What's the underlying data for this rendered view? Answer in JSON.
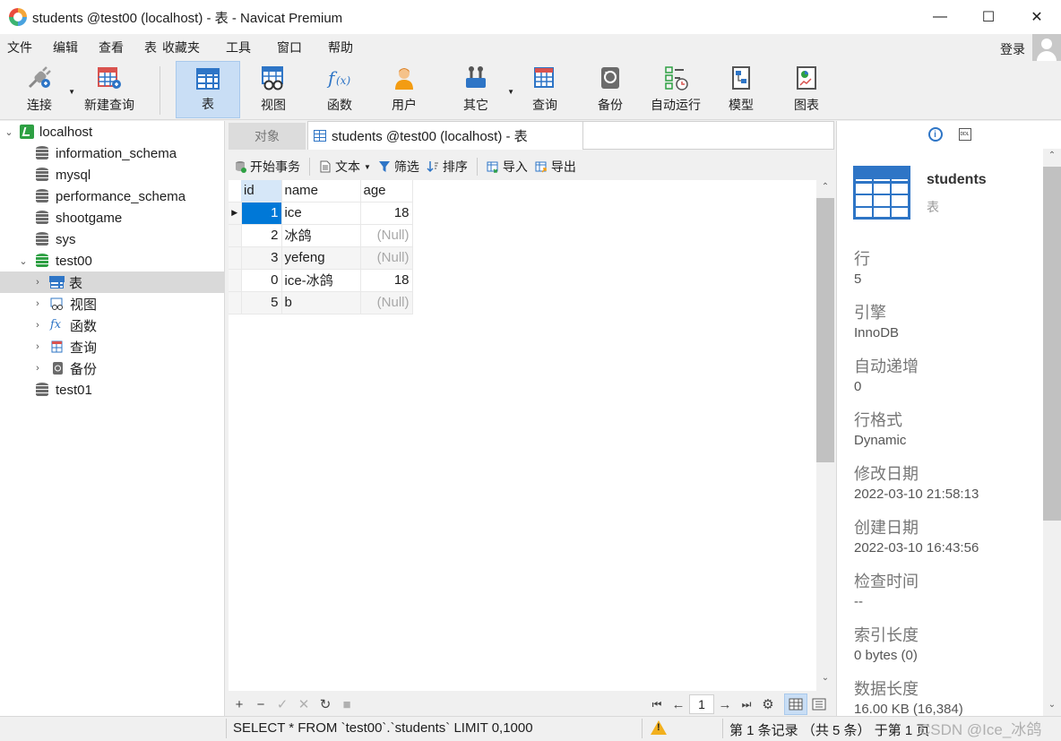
{
  "window": {
    "title": "students @test00 (localhost) - 表 - Navicat Premium",
    "min": "—",
    "max": "☐",
    "close": "✕"
  },
  "menu": [
    "文件",
    "编辑",
    "查看",
    "表",
    "收藏夹",
    "工具",
    "窗口",
    "帮助"
  ],
  "login_label": "登录",
  "toolbar": {
    "connect": "连接",
    "new_query": "新建查询",
    "table": "表",
    "view": "视图",
    "function": "函数",
    "user": "用户",
    "other": "其它",
    "query": "查询",
    "backup": "备份",
    "autorun": "自动运行",
    "model": "模型",
    "chart": "图表"
  },
  "tree": {
    "server": "localhost",
    "databases": [
      "information_schema",
      "mysql",
      "performance_schema",
      "shootgame",
      "sys"
    ],
    "open_db": "test00",
    "children": [
      "表",
      "视图",
      "函数",
      "查询",
      "备份"
    ],
    "last_db": "test01"
  },
  "tabs": {
    "objects": "对象",
    "current": "students @test00 (localhost) - 表"
  },
  "subtoolbar": {
    "begin_tx": "开始事务",
    "text": "文本",
    "filter": "筛选",
    "sort": "排序",
    "import": "导入",
    "export": "导出"
  },
  "grid": {
    "columns": [
      "id",
      "name",
      "age"
    ],
    "rows": [
      {
        "id": "1",
        "name": "ice",
        "age": "18"
      },
      {
        "id": "2",
        "name": "冰鸽",
        "age": "(Null)"
      },
      {
        "id": "3",
        "name": "yefeng",
        "age": "(Null)"
      },
      {
        "id": "0",
        "name": "ice-冰鸽",
        "age": "18"
      },
      {
        "id": "5",
        "name": "b",
        "age": "(Null)"
      }
    ]
  },
  "pager": {
    "add": "+",
    "remove": "−",
    "apply": "✓",
    "discard": "✕",
    "refresh": "↻",
    "stop": "■",
    "first": "⏮",
    "prev": "←",
    "page": "1",
    "next": "→",
    "last": "⏭",
    "settings": "⚙"
  },
  "info": {
    "table_name": "students",
    "table_type": "表",
    "props": [
      {
        "k": "行",
        "v": "5"
      },
      {
        "k": "引擎",
        "v": "InnoDB"
      },
      {
        "k": "自动递增",
        "v": "0"
      },
      {
        "k": "行格式",
        "v": "Dynamic"
      },
      {
        "k": "修改日期",
        "v": "2022-03-10 21:58:13"
      },
      {
        "k": "创建日期",
        "v": "2022-03-10 16:43:56"
      },
      {
        "k": "检查时间",
        "v": "--"
      },
      {
        "k": "索引长度",
        "v": "0 bytes (0)"
      },
      {
        "k": "数据长度",
        "v": "16.00 KB (16,384)"
      }
    ]
  },
  "status": {
    "sql": "SELECT * FROM `test00`.`students` LIMIT 0,1000",
    "record": "第 1 条记录 （共 5 条） 于第 1 页",
    "watermark": "CSDN @Ice_冰鸽"
  },
  "colors": {
    "accent": "#2e75c6",
    "selected_cell": "#0078d7",
    "toolbar_active": "#c9def5",
    "server_green": "#2ea043"
  }
}
